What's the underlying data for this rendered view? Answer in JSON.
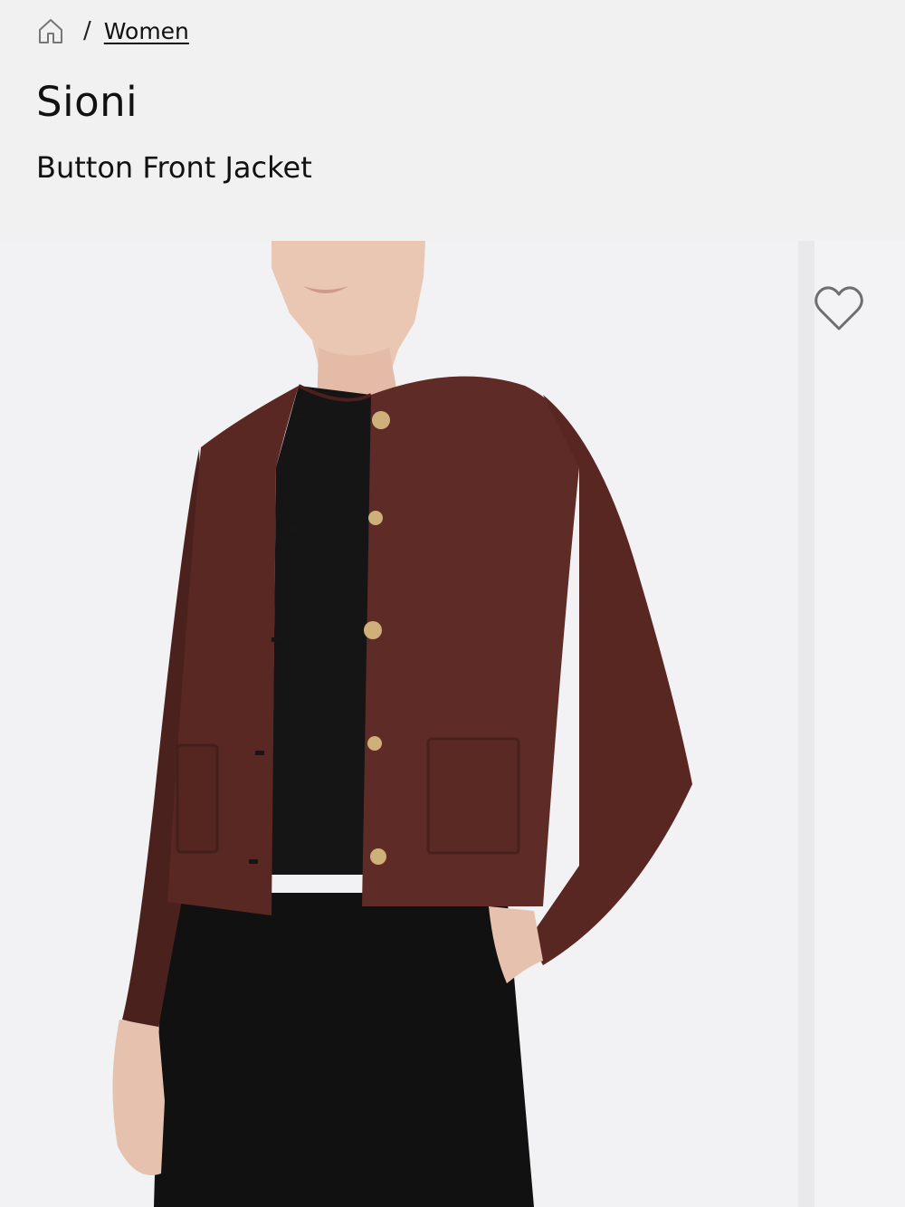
{
  "breadcrumb": {
    "home_icon": "home-icon",
    "separator": "/",
    "category": "Women"
  },
  "product": {
    "brand": "Sioni",
    "name": "Button Front Jacket",
    "favorite_icon": "heart-outline-icon"
  },
  "colors": {
    "background": "#f2f1f2",
    "jacket": "#5e2b26",
    "buttons": "#cfb07a",
    "top_and_pants": "#121212"
  }
}
